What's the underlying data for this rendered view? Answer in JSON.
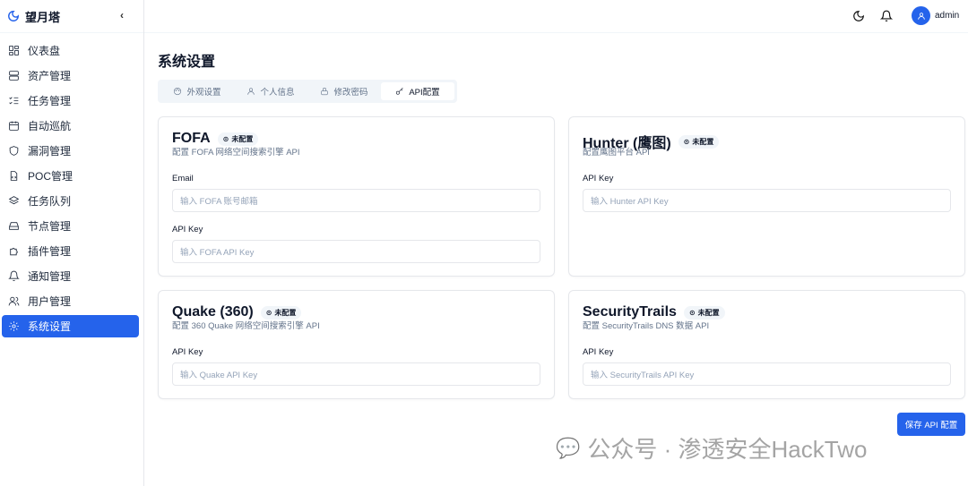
{
  "app": {
    "name": "望月塔",
    "user": "admin"
  },
  "sidebar": {
    "items": [
      {
        "label": "仪表盘",
        "icon": "dashboard-icon"
      },
      {
        "label": "资产管理",
        "icon": "server-icon"
      },
      {
        "label": "任务管理",
        "icon": "list-check-icon"
      },
      {
        "label": "自动巡航",
        "icon": "calendar-icon"
      },
      {
        "label": "漏洞管理",
        "icon": "shield-icon"
      },
      {
        "label": "POC管理",
        "icon": "file-code-icon"
      },
      {
        "label": "任务队列",
        "icon": "layers-icon"
      },
      {
        "label": "节点管理",
        "icon": "hard-drive-icon"
      },
      {
        "label": "插件管理",
        "icon": "puzzle-icon"
      },
      {
        "label": "通知管理",
        "icon": "bell-icon"
      },
      {
        "label": "用户管理",
        "icon": "users-icon"
      },
      {
        "label": "系统设置",
        "icon": "gear-icon",
        "active": true
      }
    ]
  },
  "page": {
    "title": "系统设置"
  },
  "tabs": [
    {
      "label": "外观设置"
    },
    {
      "label": "个人信息"
    },
    {
      "label": "修改密码"
    },
    {
      "label": "API配置",
      "active": true
    }
  ],
  "cards": {
    "fofa": {
      "title": "FOFA",
      "badge": "未配置",
      "desc": "配置 FOFA 网络空间搜索引擎 API",
      "email_label": "Email",
      "email_placeholder": "输入 FOFA 账号邮箱",
      "key_label": "API Key",
      "key_placeholder": "输入 FOFA API Key"
    },
    "hunter": {
      "title": "Hunter (鹰图)",
      "badge": "未配置",
      "desc": "配置鹰图平台 API",
      "key_label": "API Key",
      "key_placeholder": "输入 Hunter API Key"
    },
    "quake": {
      "title": "Quake (360)",
      "badge": "未配置",
      "desc": "配置 360 Quake 网络空间搜索引擎 API",
      "key_label": "API Key",
      "key_placeholder": "输入 Quake API Key"
    },
    "st": {
      "title": "SecurityTrails",
      "badge": "未配置",
      "desc": "配置 SecurityTrails DNS 数据 API",
      "key_label": "API Key",
      "key_placeholder": "输入 SecurityTrails API Key"
    }
  },
  "save_label": "保存 API 配置",
  "watermark": "公众号 · 渗透安全HackTwo",
  "colors": {
    "accent": "#2563eb"
  }
}
